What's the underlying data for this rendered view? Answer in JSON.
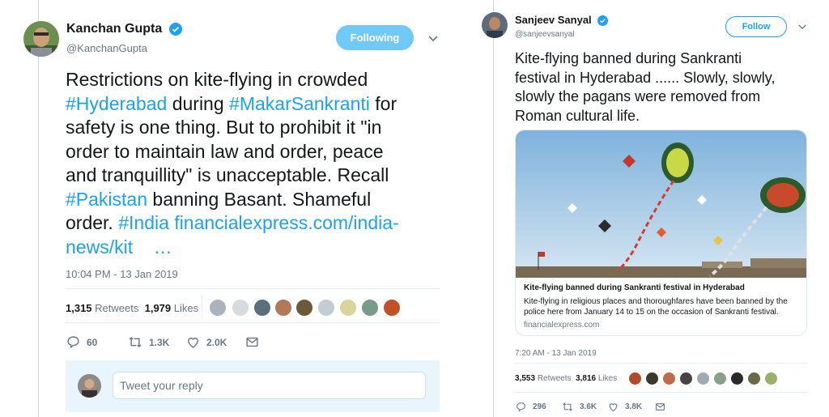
{
  "left_tweet": {
    "user": {
      "name": "Kanchan Gupta",
      "handle": "@KanchanGupta"
    },
    "follow_label": "Following",
    "text": {
      "seg1": "Restrictions on kite-flying in crowded",
      "seg2": "#Hyderabad",
      "seg3": " during ",
      "seg4": "#MakarSankranti",
      "seg5": " for",
      "seg6": "safety is one thing. But to prohibit it \"in",
      "seg7": "order to maintain law and order, peace",
      "seg8": "and tranquillity\" is unacceptable. Recall",
      "seg9": "#Pakistan",
      "seg10": " banning Basant. Shameful",
      "seg11": "order. ",
      "seg12": "#India",
      "seg13": " financialexpress.com/india-",
      "seg14": "news/kit    …"
    },
    "timestamp": "10:04 PM - 13 Jan 2019",
    "stats": {
      "retweets_count": "1,315",
      "retweets_label": "Retweets",
      "likes_count": "1,979",
      "likes_label": "Likes"
    },
    "actions": {
      "replies": "60",
      "retweets": "1.3K",
      "likes": "2.0K"
    },
    "reply_placeholder": "Tweet your reply",
    "colors": {
      "accent": "#1da1f2",
      "following_bg": "#71c9f8"
    }
  },
  "right_tweet": {
    "user": {
      "name": "Sanjeev Sanyal",
      "handle": "@sanjeevsanyal"
    },
    "follow_label": "Follow",
    "text": {
      "line1": "Kite-flying banned during Sankranti",
      "line2": "festival in Hyderabad ...... Slowly, slowly,",
      "line3": "slowly the pagans were removed from",
      "line4": "Roman cultural life."
    },
    "card": {
      "title": "Kite-flying banned during Sankranti festival in Hyderabad",
      "description": "Kite-flying in religious places and thoroughfares have been banned by the police here from January 14 to 15 on the occasion of Sankranti festival.",
      "domain": "financialexpress.com"
    },
    "timestamp": "7:20 AM - 13 Jan 2019",
    "stats": {
      "retweets_count": "3,553",
      "retweets_label": "Retweets",
      "likes_count": "3,816",
      "likes_label": "Likes"
    },
    "actions": {
      "replies": "296",
      "retweets": "3.6K",
      "likes": "3.8K"
    }
  }
}
